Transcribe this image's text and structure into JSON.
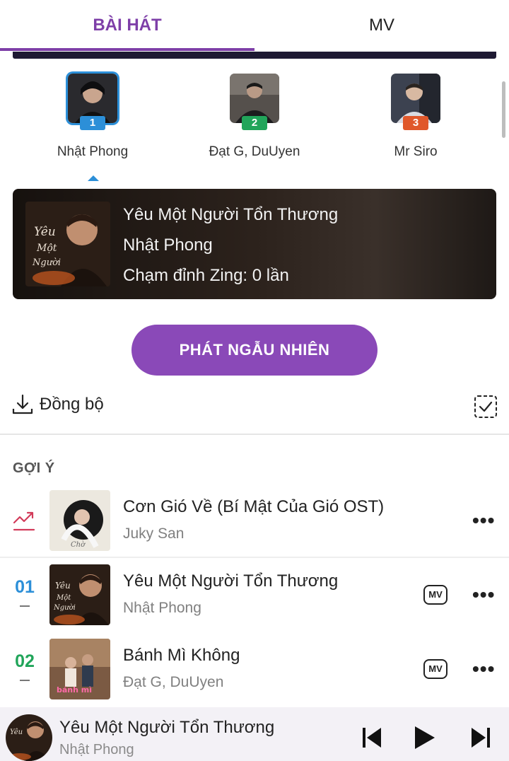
{
  "tabs": {
    "songs": "BÀI HÁT",
    "mv": "MV"
  },
  "top_artists": [
    {
      "rank": "1",
      "name": "Nhật Phong",
      "badge_color": "#2c8fd8",
      "selected": true
    },
    {
      "rank": "2",
      "name": "Đạt G, DuUyen",
      "badge_color": "#21a55a",
      "selected": false
    },
    {
      "rank": "3",
      "name": "Mr Siro",
      "badge_color": "#e0582b",
      "selected": false
    }
  ],
  "featured": {
    "title": "Yêu Một Người Tổn Thương",
    "artist": "Nhật Phong",
    "peak": "Chạm đỉnh Zing: 0 lần"
  },
  "shuffle_label": "PHÁT NGẪU NHIÊN",
  "sync_label": "Đồng bộ",
  "section_title": "GỢI Ý",
  "songs": [
    {
      "title": "Cơn Gió Về (Bí Mật Của Gió OST)",
      "artist": "Juky San",
      "indicator": "trending-icon"
    },
    {
      "rank": "01",
      "rank_color": "#2c8fd8",
      "title": "Yêu Một Người Tổn Thương",
      "artist": "Nhật Phong",
      "mv": "MV"
    },
    {
      "rank": "02",
      "rank_color": "#21a55a",
      "title": "Bánh Mì Không",
      "artist": "Đạt G, DuUyen",
      "mv": "MV"
    }
  ],
  "now_playing": {
    "title": "Yêu Một Người Tổn Thương",
    "artist": "Nhật Phong"
  },
  "colors": {
    "accent": "#8a49b8",
    "tab_active": "#7e3fa8"
  }
}
